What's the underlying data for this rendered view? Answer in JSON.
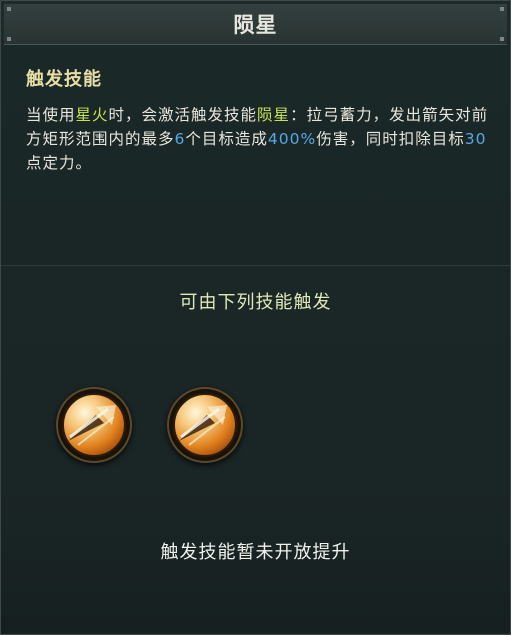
{
  "window": {
    "title": "陨星"
  },
  "trigger_skill": {
    "heading": "触发技能",
    "description": {
      "p1": "当使用",
      "skill_name": "星火",
      "p2": "时，会激活触发技能",
      "trigger_name": "陨星",
      "p3": "：拉弓蓄力，发出箭矢对前方矩形范围内的最多",
      "target_count": "6",
      "p4": "个目标造成",
      "damage_percent": "400%",
      "p5": "伤害，同时扣除目标",
      "poise_points": "30",
      "p6": "点定力。"
    }
  },
  "triggered_by": {
    "heading": "可由下列技能触发",
    "skills": [
      {
        "icon": "arrow-shot-skill-icon"
      },
      {
        "icon": "arrow-shot-skill-icon"
      }
    ]
  },
  "footer": {
    "note": "触发技能暂未开放提升"
  },
  "colors": {
    "highlight_skill": "#c9e24a",
    "highlight_number": "#55a9e6",
    "heading": "#e7dfa6",
    "icon_orange": "#e58a1f"
  }
}
